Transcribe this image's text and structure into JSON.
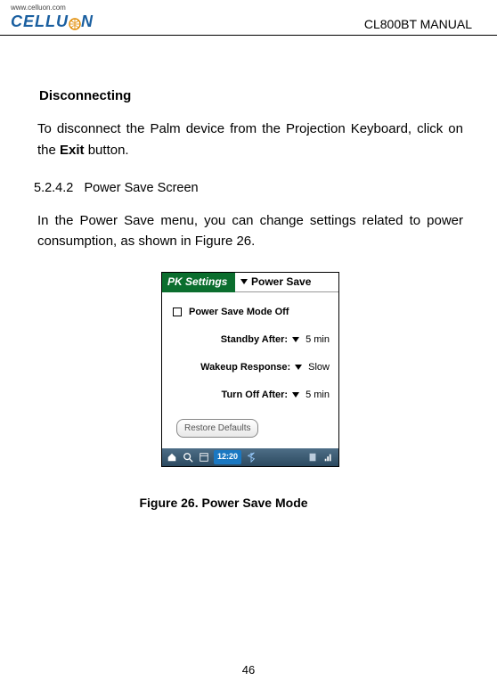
{
  "header": {
    "logo_url": "www.celluon.com",
    "logo_text": "CELLUON",
    "doc_title": "CL800BT MANUAL"
  },
  "body": {
    "h_disconnecting": "Disconnecting",
    "p_disconnect_1": "To disconnect the Palm device from the Projection Keyboard, click on the ",
    "p_disconnect_bold": "Exit",
    "p_disconnect_2": " button.",
    "h_section_num": "5.2.4.2",
    "h_section_title": "Power Save Screen",
    "p_power": "In the Power Save menu, you can change settings related to power consumption, as shown in Figure 26."
  },
  "device": {
    "header_left": "PK Settings",
    "header_right": "Power Save",
    "mode_label": "Power Save Mode Off",
    "standby_label": "Standby After:",
    "standby_value": "5 min",
    "wakeup_label": "Wakeup Response:",
    "wakeup_value": "Slow",
    "turnoff_label": "Turn Off After:",
    "turnoff_value": "5 min",
    "restore_label": "Restore Defaults",
    "clock": "12:20"
  },
  "caption": "Figure 26. Power Save Mode",
  "page_number": "46"
}
